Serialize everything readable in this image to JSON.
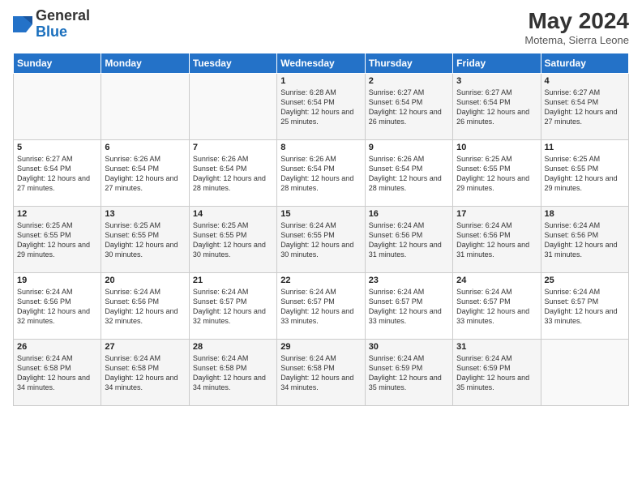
{
  "header": {
    "logo": {
      "general": "General",
      "blue": "Blue"
    },
    "month_year": "May 2024",
    "location": "Motema, Sierra Leone"
  },
  "calendar": {
    "headers": [
      "Sunday",
      "Monday",
      "Tuesday",
      "Wednesday",
      "Thursday",
      "Friday",
      "Saturday"
    ],
    "weeks": [
      [
        {
          "day": "",
          "info": ""
        },
        {
          "day": "",
          "info": ""
        },
        {
          "day": "",
          "info": ""
        },
        {
          "day": "1",
          "info": "Sunrise: 6:28 AM\nSunset: 6:54 PM\nDaylight: 12 hours\nand 25 minutes."
        },
        {
          "day": "2",
          "info": "Sunrise: 6:27 AM\nSunset: 6:54 PM\nDaylight: 12 hours\nand 26 minutes."
        },
        {
          "day": "3",
          "info": "Sunrise: 6:27 AM\nSunset: 6:54 PM\nDaylight: 12 hours\nand 26 minutes."
        },
        {
          "day": "4",
          "info": "Sunrise: 6:27 AM\nSunset: 6:54 PM\nDaylight: 12 hours\nand 27 minutes."
        }
      ],
      [
        {
          "day": "5",
          "info": "Sunrise: 6:27 AM\nSunset: 6:54 PM\nDaylight: 12 hours\nand 27 minutes."
        },
        {
          "day": "6",
          "info": "Sunrise: 6:26 AM\nSunset: 6:54 PM\nDaylight: 12 hours\nand 27 minutes."
        },
        {
          "day": "7",
          "info": "Sunrise: 6:26 AM\nSunset: 6:54 PM\nDaylight: 12 hours\nand 28 minutes."
        },
        {
          "day": "8",
          "info": "Sunrise: 6:26 AM\nSunset: 6:54 PM\nDaylight: 12 hours\nand 28 minutes."
        },
        {
          "day": "9",
          "info": "Sunrise: 6:26 AM\nSunset: 6:54 PM\nDaylight: 12 hours\nand 28 minutes."
        },
        {
          "day": "10",
          "info": "Sunrise: 6:25 AM\nSunset: 6:55 PM\nDaylight: 12 hours\nand 29 minutes."
        },
        {
          "day": "11",
          "info": "Sunrise: 6:25 AM\nSunset: 6:55 PM\nDaylight: 12 hours\nand 29 minutes."
        }
      ],
      [
        {
          "day": "12",
          "info": "Sunrise: 6:25 AM\nSunset: 6:55 PM\nDaylight: 12 hours\nand 29 minutes."
        },
        {
          "day": "13",
          "info": "Sunrise: 6:25 AM\nSunset: 6:55 PM\nDaylight: 12 hours\nand 30 minutes."
        },
        {
          "day": "14",
          "info": "Sunrise: 6:25 AM\nSunset: 6:55 PM\nDaylight: 12 hours\nand 30 minutes."
        },
        {
          "day": "15",
          "info": "Sunrise: 6:24 AM\nSunset: 6:55 PM\nDaylight: 12 hours\nand 30 minutes."
        },
        {
          "day": "16",
          "info": "Sunrise: 6:24 AM\nSunset: 6:56 PM\nDaylight: 12 hours\nand 31 minutes."
        },
        {
          "day": "17",
          "info": "Sunrise: 6:24 AM\nSunset: 6:56 PM\nDaylight: 12 hours\nand 31 minutes."
        },
        {
          "day": "18",
          "info": "Sunrise: 6:24 AM\nSunset: 6:56 PM\nDaylight: 12 hours\nand 31 minutes."
        }
      ],
      [
        {
          "day": "19",
          "info": "Sunrise: 6:24 AM\nSunset: 6:56 PM\nDaylight: 12 hours\nand 32 minutes."
        },
        {
          "day": "20",
          "info": "Sunrise: 6:24 AM\nSunset: 6:56 PM\nDaylight: 12 hours\nand 32 minutes."
        },
        {
          "day": "21",
          "info": "Sunrise: 6:24 AM\nSunset: 6:57 PM\nDaylight: 12 hours\nand 32 minutes."
        },
        {
          "day": "22",
          "info": "Sunrise: 6:24 AM\nSunset: 6:57 PM\nDaylight: 12 hours\nand 33 minutes."
        },
        {
          "day": "23",
          "info": "Sunrise: 6:24 AM\nSunset: 6:57 PM\nDaylight: 12 hours\nand 33 minutes."
        },
        {
          "day": "24",
          "info": "Sunrise: 6:24 AM\nSunset: 6:57 PM\nDaylight: 12 hours\nand 33 minutes."
        },
        {
          "day": "25",
          "info": "Sunrise: 6:24 AM\nSunset: 6:57 PM\nDaylight: 12 hours\nand 33 minutes."
        }
      ],
      [
        {
          "day": "26",
          "info": "Sunrise: 6:24 AM\nSunset: 6:58 PM\nDaylight: 12 hours\nand 34 minutes."
        },
        {
          "day": "27",
          "info": "Sunrise: 6:24 AM\nSunset: 6:58 PM\nDaylight: 12 hours\nand 34 minutes."
        },
        {
          "day": "28",
          "info": "Sunrise: 6:24 AM\nSunset: 6:58 PM\nDaylight: 12 hours\nand 34 minutes."
        },
        {
          "day": "29",
          "info": "Sunrise: 6:24 AM\nSunset: 6:58 PM\nDaylight: 12 hours\nand 34 minutes."
        },
        {
          "day": "30",
          "info": "Sunrise: 6:24 AM\nSunset: 6:59 PM\nDaylight: 12 hours\nand 35 minutes."
        },
        {
          "day": "31",
          "info": "Sunrise: 6:24 AM\nSunset: 6:59 PM\nDaylight: 12 hours\nand 35 minutes."
        },
        {
          "day": "",
          "info": ""
        }
      ]
    ]
  }
}
